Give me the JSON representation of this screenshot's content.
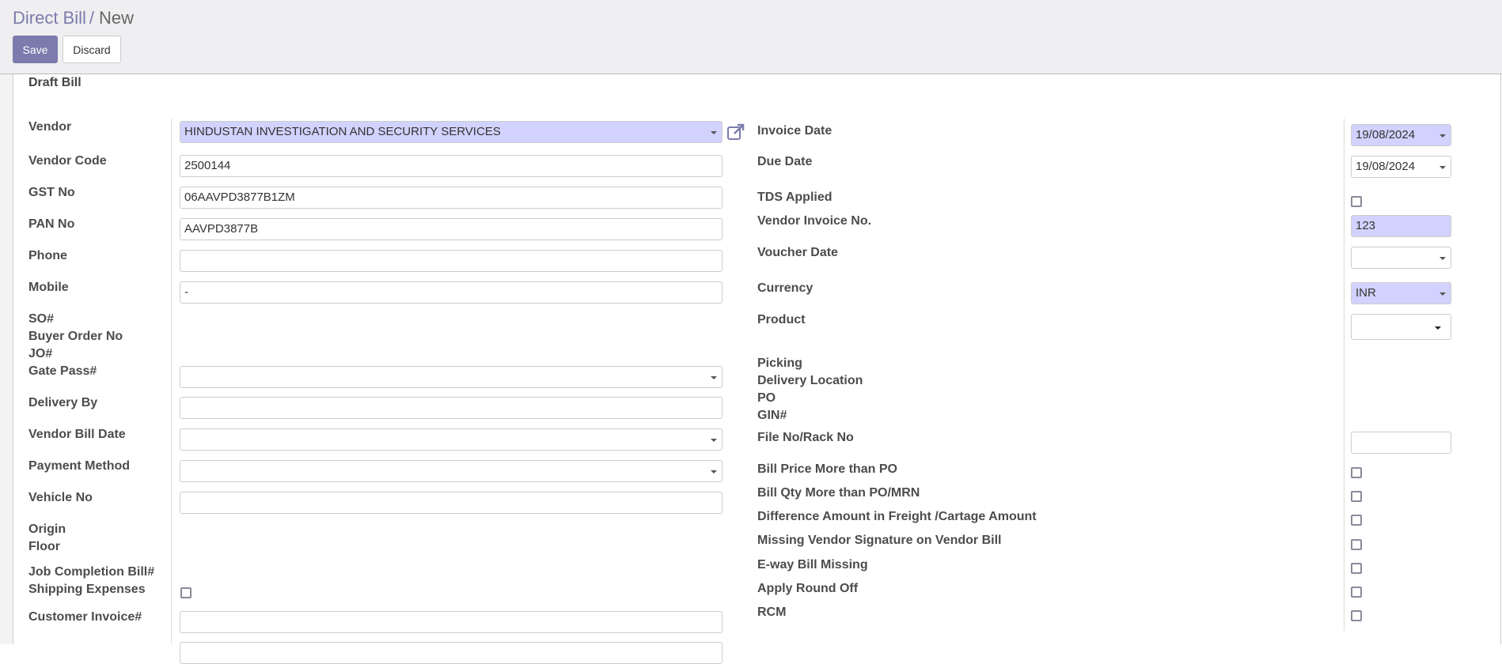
{
  "breadcrumb": {
    "parent": "Direct Bill",
    "separator": "/",
    "current": "New"
  },
  "toolbar": {
    "save_label": "Save",
    "discard_label": "Discard"
  },
  "status": "Draft Bill",
  "left": {
    "vendor": {
      "label": "Vendor",
      "value": "HINDUSTAN INVESTIGATION AND SECURITY  SERVICES"
    },
    "vendor_code": {
      "label": "Vendor Code",
      "value": "2500144"
    },
    "gst_no": {
      "label": "GST No",
      "value": "06AAVPD3877B1ZM"
    },
    "pan_no": {
      "label": "PAN No",
      "value": "AAVPD3877B"
    },
    "phone": {
      "label": "Phone",
      "value": ""
    },
    "mobile": {
      "label": "Mobile",
      "value": "-"
    },
    "so": {
      "label": "SO#"
    },
    "buyer_order": {
      "label": "Buyer Order No"
    },
    "jo": {
      "label": "JO#"
    },
    "gate_pass": {
      "label": "Gate Pass#",
      "value": ""
    },
    "delivery_by": {
      "label": "Delivery By",
      "value": ""
    },
    "vendor_bill_date": {
      "label": "Vendor Bill Date",
      "value": ""
    },
    "payment_method": {
      "label": "Payment Method",
      "value": ""
    },
    "vehicle_no": {
      "label": "Vehicle No",
      "value": ""
    },
    "origin": {
      "label": "Origin"
    },
    "floor": {
      "label": "Floor"
    },
    "job_completion": {
      "label": "Job Completion Bill#"
    },
    "shipping_expenses": {
      "label": "Shipping Expenses",
      "checked": false
    },
    "customer_invoice": {
      "label": "Customer Invoice#",
      "value": ""
    }
  },
  "right": {
    "invoice_date": {
      "label": "Invoice Date",
      "value": "19/08/2024"
    },
    "due_date": {
      "label": "Due Date",
      "value": "19/08/2024"
    },
    "tds_applied": {
      "label": "TDS Applied",
      "checked": false
    },
    "vendor_invoice_no": {
      "label": "Vendor Invoice No.",
      "value": "123"
    },
    "voucher_date": {
      "label": "Voucher Date",
      "value": ""
    },
    "currency": {
      "label": "Currency",
      "value": "INR"
    },
    "product": {
      "label": "Product",
      "value": ""
    },
    "picking": {
      "label": "Picking"
    },
    "delivery_location": {
      "label": "Delivery Location"
    },
    "po": {
      "label": "PO"
    },
    "gin": {
      "label": "GIN#"
    },
    "file_no": {
      "label": "File No/Rack No",
      "value": ""
    },
    "bill_price": {
      "label": "Bill Price More than PO",
      "checked": false
    },
    "bill_qty": {
      "label": "Bill Qty More than PO/MRN",
      "checked": false
    },
    "freight_diff": {
      "label": "Difference Amount in Freight /Cartage Amount",
      "checked": false
    },
    "missing_signature": {
      "label": "Missing Vendor Signature on Vendor Bill",
      "checked": false
    },
    "eway_missing": {
      "label": "E-way Bill Missing",
      "checked": false
    },
    "round_off": {
      "label": "Apply Round Off",
      "checked": false
    },
    "rcm": {
      "label": "RCM",
      "checked": false
    }
  },
  "colors": {
    "accent": "#7c7bad",
    "required_bg": "#d2d2ff",
    "header_bg": "#efeef0"
  }
}
